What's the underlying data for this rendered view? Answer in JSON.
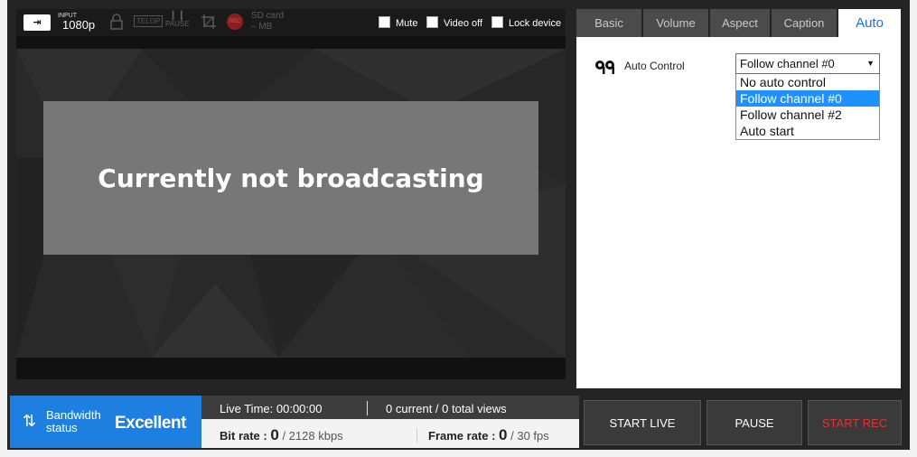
{
  "topbar": {
    "input_label": "INPUT",
    "input_icon": "input-icon",
    "resolution": "1080p",
    "telop": "TELOP",
    "pause": "PAUSE",
    "rec_label": "REC",
    "sd_card": "SD card",
    "sd_value": "– MB",
    "mute_label": "Mute",
    "video_off_label": "Video off",
    "lock_device_label": "Lock device"
  },
  "preview": {
    "notice": "Currently not broadcasting"
  },
  "tabs": [
    {
      "label": "Basic",
      "active": false
    },
    {
      "label": "Volume",
      "active": false
    },
    {
      "label": "Aspect",
      "active": false
    },
    {
      "label": "Caption",
      "active": false
    },
    {
      "label": "Auto",
      "active": true
    }
  ],
  "auto": {
    "label": "Auto Control",
    "selected": "Follow channel #0",
    "options": [
      "No auto control",
      "Follow channel #0",
      "Follow channel #2",
      "Auto start"
    ],
    "selected_index": 1
  },
  "status": {
    "bandwidth_label_1": "Bandwidth",
    "bandwidth_label_2": "status",
    "bandwidth_value": "Excellent",
    "live_time_label": "Live Time:",
    "live_time": "00:00:00",
    "views": "0 current / 0 total views",
    "bit_rate_label": "Bit rate :",
    "bit_rate": "0",
    "bit_rate_unit": "/ 2128 kbps",
    "frame_rate_label": "Frame rate :",
    "frame_rate": "0",
    "frame_rate_unit": "/ 30 fps"
  },
  "buttons": {
    "start_live": "START LIVE",
    "pause": "PAUSE",
    "start_rec": "START REC"
  },
  "colors": {
    "accent": "#1e7fe0",
    "rec": "#e23232",
    "tab_active_text": "#1f6fd6"
  }
}
